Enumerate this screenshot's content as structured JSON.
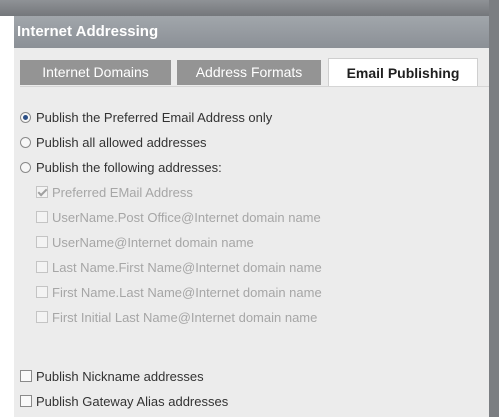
{
  "panel": {
    "title": "Internet Addressing"
  },
  "tabs": [
    {
      "label": "Internet Domains",
      "active": false
    },
    {
      "label": "Address Formats",
      "active": false
    },
    {
      "label": "Email Publishing",
      "active": true
    }
  ],
  "publishing": {
    "radios": [
      {
        "label": "Publish the Preferred Email Address only",
        "checked": true
      },
      {
        "label": "Publish all allowed addresses",
        "checked": false
      },
      {
        "label": "Publish the following addresses:",
        "checked": false
      }
    ],
    "address_checkboxes": [
      {
        "label": "Preferred EMail Address",
        "checked": true,
        "enabled": false
      },
      {
        "label": "UserName.Post Office@Internet domain name",
        "checked": false,
        "enabled": false
      },
      {
        "label": "UserName@Internet domain name",
        "checked": false,
        "enabled": false
      },
      {
        "label": "Last Name.First Name@Internet domain name",
        "checked": false,
        "enabled": false
      },
      {
        "label": "First Name.Last Name@Internet domain name",
        "checked": false,
        "enabled": false
      },
      {
        "label": "First Initial Last Name@Internet domain name",
        "checked": false,
        "enabled": false
      }
    ],
    "extra_checkboxes": [
      {
        "label": "Publish Nickname addresses",
        "checked": false
      },
      {
        "label": "Publish Gateway Alias addresses",
        "checked": false
      }
    ]
  },
  "colors": {
    "title_bar": "#9a9fa4",
    "inactive_tab": "#949494",
    "panel_bg": "#ececec",
    "disabled_text": "#a6a6a6"
  }
}
